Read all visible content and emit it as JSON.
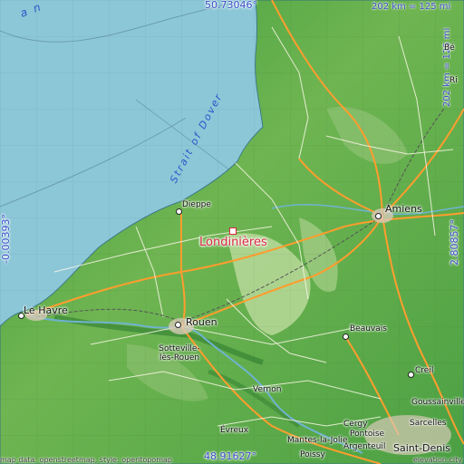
{
  "map": {
    "highlight_city": "Londinières",
    "colors": {
      "sea": "#8cc7d8",
      "coast": "#5a8fa0",
      "lowland": "#3f9a3c",
      "upland": "#b6d79a",
      "road_major": "#ff9d2e",
      "road_minor": "#ffffff",
      "highlight": "#d8283c",
      "coords": "#3a4fc8"
    }
  },
  "coords": {
    "top": "50.73046°",
    "bottom": "48.91627°",
    "left": "-0.00393°",
    "right": "2.80857°"
  },
  "scale": {
    "horizontal": "202 km = 125 mi",
    "vertical": "202 km = 125 mi"
  },
  "sea_labels": {
    "strait": "Strait of Dover",
    "channel_fragment": "a n"
  },
  "cities": {
    "amiens": "Amiens",
    "dieppe": "Dieppe",
    "le_havre": "Le Havre",
    "rouen": "Rouen",
    "sotteville": "Sotteville-lès-Rouen",
    "beauvais": "Beauvais",
    "creil": "Creil",
    "vernon": "Vernon",
    "evreux": "Évreux",
    "cergy": "Cergy",
    "pontoise": "Pontoise",
    "sarcelles": "Sarcelles",
    "goussainville": "Goussainville",
    "mantes": "Mantes-la-Jolie",
    "argenteuil": "Argenteuil",
    "poissy": "Poissy",
    "saint_denis": "Saint-Denis",
    "be_fragment": "Bé",
    "ri_fragment": "Ri"
  },
  "credit": "map data: openstreetmap, style: opentopomap",
  "credit_right": "elevation.city"
}
